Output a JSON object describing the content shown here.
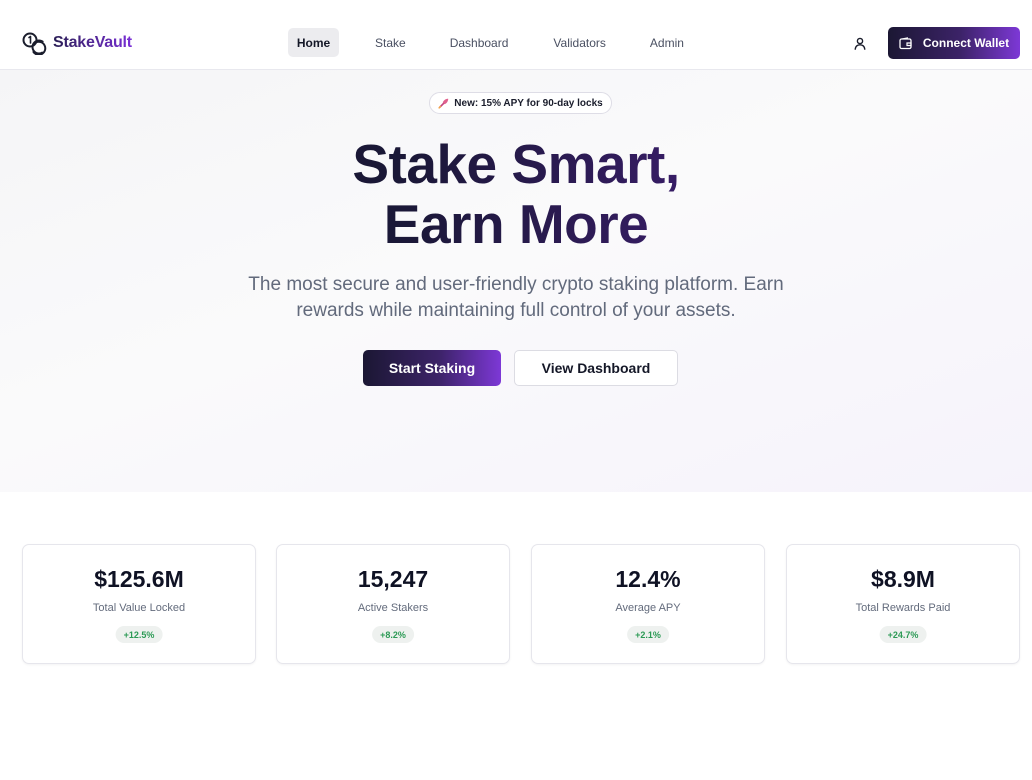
{
  "brand": {
    "name": "StakeVault",
    "logo_icon": "coins-icon"
  },
  "nav": {
    "items": [
      {
        "label": "Home",
        "active": true
      },
      {
        "label": "Stake",
        "active": false
      },
      {
        "label": "Dashboard",
        "active": false
      },
      {
        "label": "Validators",
        "active": false
      },
      {
        "label": "Admin",
        "active": false
      }
    ]
  },
  "header": {
    "user_icon": "user-icon",
    "connect_label": "Connect Wallet",
    "connect_icon": "wallet-icon"
  },
  "hero": {
    "badge_text": "New: 15% APY for 90-day locks",
    "badge_icon": "rocket-icon",
    "title_line1": "Stake Smart,",
    "title_line2": "Earn More",
    "subtitle": "The most secure and user-friendly crypto staking platform. Earn rewards while maintaining full control of your assets.",
    "primary_cta": "Start Staking",
    "secondary_cta": "View Dashboard"
  },
  "stats": [
    {
      "value": "$125.6M",
      "label": "Total Value Locked",
      "change": "+12.5%"
    },
    {
      "value": "15,247",
      "label": "Active Stakers",
      "change": "+8.2%"
    },
    {
      "value": "12.4%",
      "label": "Average APY",
      "change": "+2.1%"
    },
    {
      "value": "$8.9M",
      "label": "Total Rewards Paid",
      "change": "+24.7%"
    }
  ],
  "colors": {
    "brand_gradient_start": "#1b1733",
    "brand_gradient_end": "#7d38d6",
    "positive": "#2c9a55"
  }
}
